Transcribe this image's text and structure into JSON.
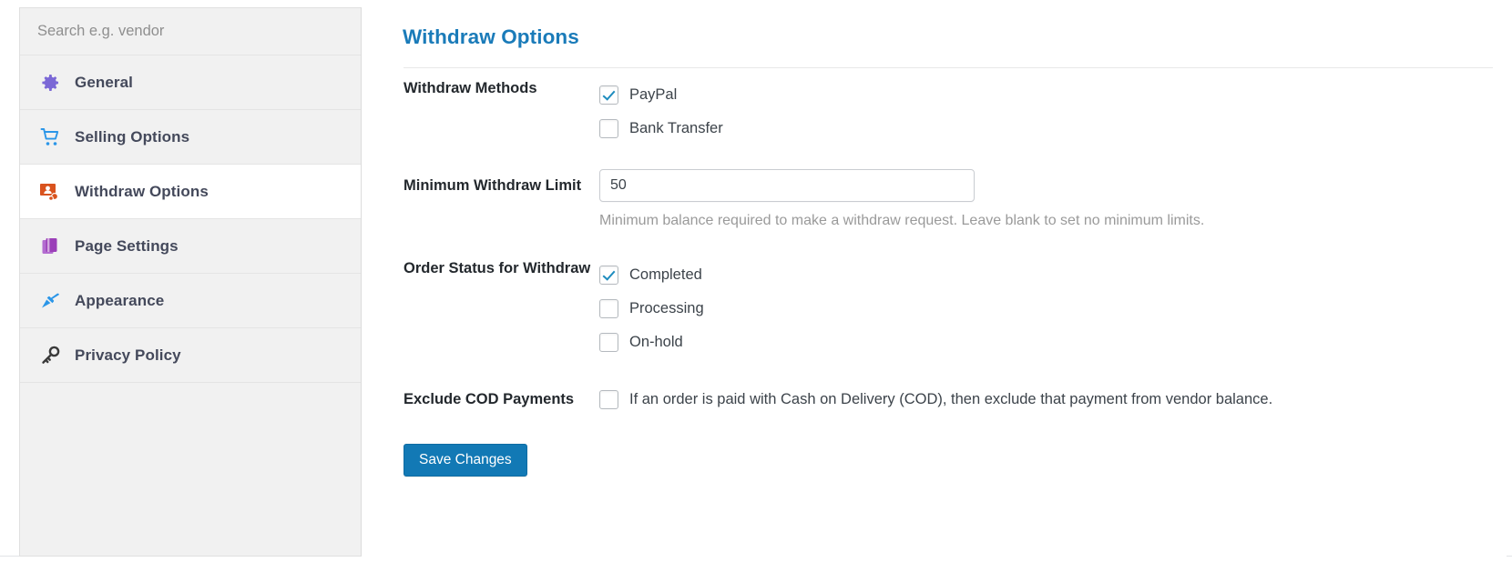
{
  "sidebar": {
    "search": {
      "placeholder": "Search e.g. vendor",
      "value": ""
    },
    "items": [
      {
        "label": "General",
        "icon": "gear-icon",
        "active": false
      },
      {
        "label": "Selling Options",
        "icon": "cart-icon",
        "active": false
      },
      {
        "label": "Withdraw Options",
        "icon": "withdraw-icon",
        "active": true
      },
      {
        "label": "Page Settings",
        "icon": "pages-icon",
        "active": false
      },
      {
        "label": "Appearance",
        "icon": "brush-icon",
        "active": false
      },
      {
        "label": "Privacy Policy",
        "icon": "key-icon",
        "active": false
      }
    ]
  },
  "panel": {
    "title": "Withdraw Options",
    "rows": {
      "withdraw_methods": {
        "label": "Withdraw Methods",
        "options": [
          {
            "label": "PayPal",
            "checked": true
          },
          {
            "label": "Bank Transfer",
            "checked": false
          }
        ]
      },
      "minimum_withdraw_limit": {
        "label": "Minimum Withdraw Limit",
        "value": "50",
        "placeholder": "",
        "help": "Minimum balance required to make a withdraw request. Leave blank to set no minimum limits."
      },
      "order_status": {
        "label": "Order Status for Withdraw",
        "options": [
          {
            "label": "Completed",
            "checked": true
          },
          {
            "label": "Processing",
            "checked": false
          },
          {
            "label": "On-hold",
            "checked": false
          }
        ]
      },
      "exclude_cod": {
        "label": "Exclude COD Payments",
        "options": [
          {
            "label": "If an order is paid with Cash on Delivery (COD), then exclude that payment from vendor balance.",
            "checked": false
          }
        ]
      }
    },
    "save_label": "Save Changes"
  },
  "colors": {
    "title_blue": "#1a7bb9",
    "button_blue": "#1279b5",
    "checkbox_check": "#1e8cbe",
    "sidebar_bg": "#f1f1f1",
    "icon_gear": "#7b68d6",
    "icon_cart": "#2b96e8",
    "icon_withdraw": "#d9531e",
    "icon_pages": "#9b3fb8",
    "icon_brush": "#2b96e8",
    "icon_key": "#3a3a3a"
  }
}
